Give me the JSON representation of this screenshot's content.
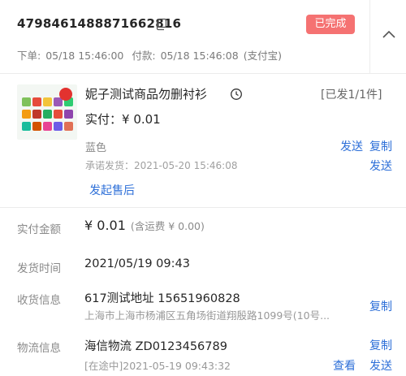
{
  "order": {
    "number": "4798461488871662816",
    "status": "已完成",
    "order_time_label": "下单:",
    "order_time": "05/18 15:46:00",
    "pay_time_label": "付款:",
    "pay_time": "05/18 15:46:08",
    "pay_method": "(支付宝)"
  },
  "product": {
    "name": "妮子测试商品勿删衬衫",
    "shipped_count": "[已发1/1件]",
    "paid_label": "实付：",
    "paid_amount": "¥ 0.01",
    "color": "蓝色",
    "promise_label": "承诺发货：",
    "promise_time": "2021-05-20 15:46:08",
    "after_sale_label": "发起售后",
    "ship_link": "发送",
    "copy_link": "复制",
    "ship_link2": "发送"
  },
  "amount_row": {
    "label": "实付金额",
    "value": "¥ 0.01",
    "note": "(含运费 ¥ 0.00)"
  },
  "ship_time_row": {
    "label": "发货时间",
    "value": "2021/05/19 09:43"
  },
  "receiver_row": {
    "label": "收货信息",
    "name_phone": "617测试地址  15651960828",
    "address": "上海市上海市杨浦区五角场街道翔殷路1099号(10号...",
    "copy_link": "复制"
  },
  "logistics_row": {
    "label": "物流信息",
    "carrier": "海信物流  ZD0123456789",
    "status": "[在途中]2021-05-19 09:43:32",
    "copy_link": "复制",
    "view_link": "查看",
    "send_link": "发送"
  },
  "colors": {
    "accent_link": "#2d6fd8",
    "status_badge": "#f57272"
  },
  "icons": [
    "copy-icon",
    "chevron-up-icon",
    "clock-icon"
  ]
}
